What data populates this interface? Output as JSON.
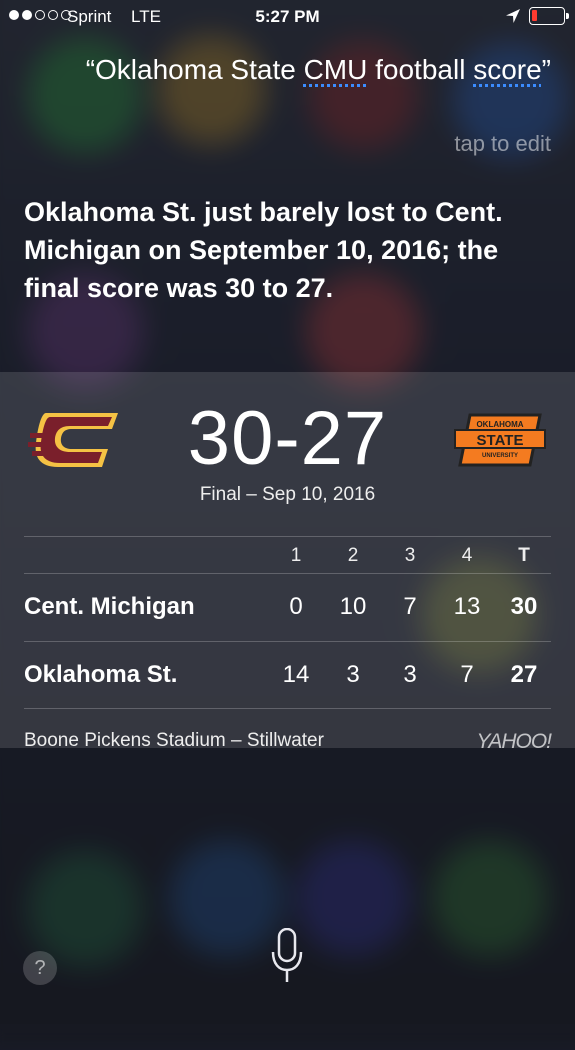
{
  "status_bar": {
    "carrier": "Sprint",
    "network": "LTE",
    "time": "5:27 PM",
    "signal_bars_filled": 2,
    "signal_bars_total": 5,
    "battery_level": "low",
    "icons": [
      "location-arrow-icon",
      "battery-icon"
    ]
  },
  "siri": {
    "query_prefix": "“Oklahoma State ",
    "query_underlined_1": "CMU",
    "query_middle": " football ",
    "query_underlined_2": "score",
    "query_suffix": "”",
    "tap_to_edit": "tap to edit",
    "answer": "Oklahoma St. just barely lost to Cent. Michigan on September 10, 2016; the final score was 30 to 27."
  },
  "scorecard": {
    "score": "30-27",
    "status": "Final – Sep 10, 2016",
    "home_logo": "central-michigan-logo",
    "away_logo": "oklahoma-state-logo",
    "away_logo_text": [
      "OKLAHOMA",
      "STATE",
      "UNIVERSITY"
    ],
    "headers": [
      "1",
      "2",
      "3",
      "4",
      "T"
    ],
    "teams": [
      {
        "name": "Cent. Michigan",
        "quarters": [
          "0",
          "10",
          "7",
          "13"
        ],
        "total": "30"
      },
      {
        "name": "Oklahoma St.",
        "quarters": [
          "14",
          "3",
          "3",
          "7"
        ],
        "total": "27"
      }
    ],
    "venue": "Boone Pickens Stadium – Stillwater",
    "source": "YAHOO!"
  },
  "controls": {
    "help_label": "?",
    "mic": "microphone-icon"
  },
  "colors": {
    "cmu_maroon": "#7a1f2b",
    "cmu_gold": "#f5c244",
    "osu_orange": "#f47b20",
    "link_underline": "#3b8cff",
    "battery_low": "#ff3b30"
  }
}
